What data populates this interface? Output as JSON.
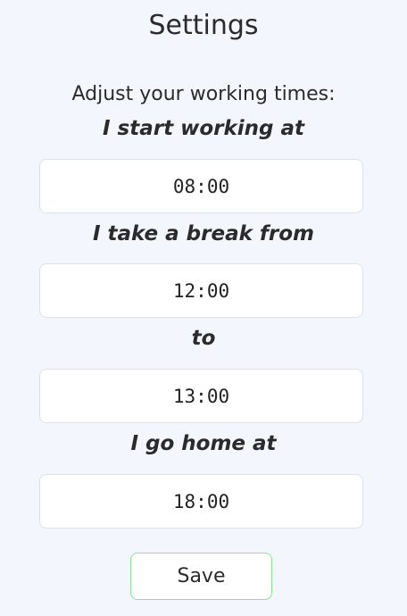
{
  "header": {
    "title": "Settings"
  },
  "form": {
    "intro": "Adjust your working times:",
    "fields": [
      {
        "label": "I start working at",
        "value": "08:00"
      },
      {
        "label": "I take a break from",
        "value": "12:00"
      },
      {
        "label": "to",
        "value": "13:00"
      },
      {
        "label": "I go home at",
        "value": "18:00"
      }
    ],
    "save_label": "Save"
  },
  "colors": {
    "background": "#f4f6fe",
    "input_border": "#dde1ea",
    "save_border": "#8fe09a"
  }
}
